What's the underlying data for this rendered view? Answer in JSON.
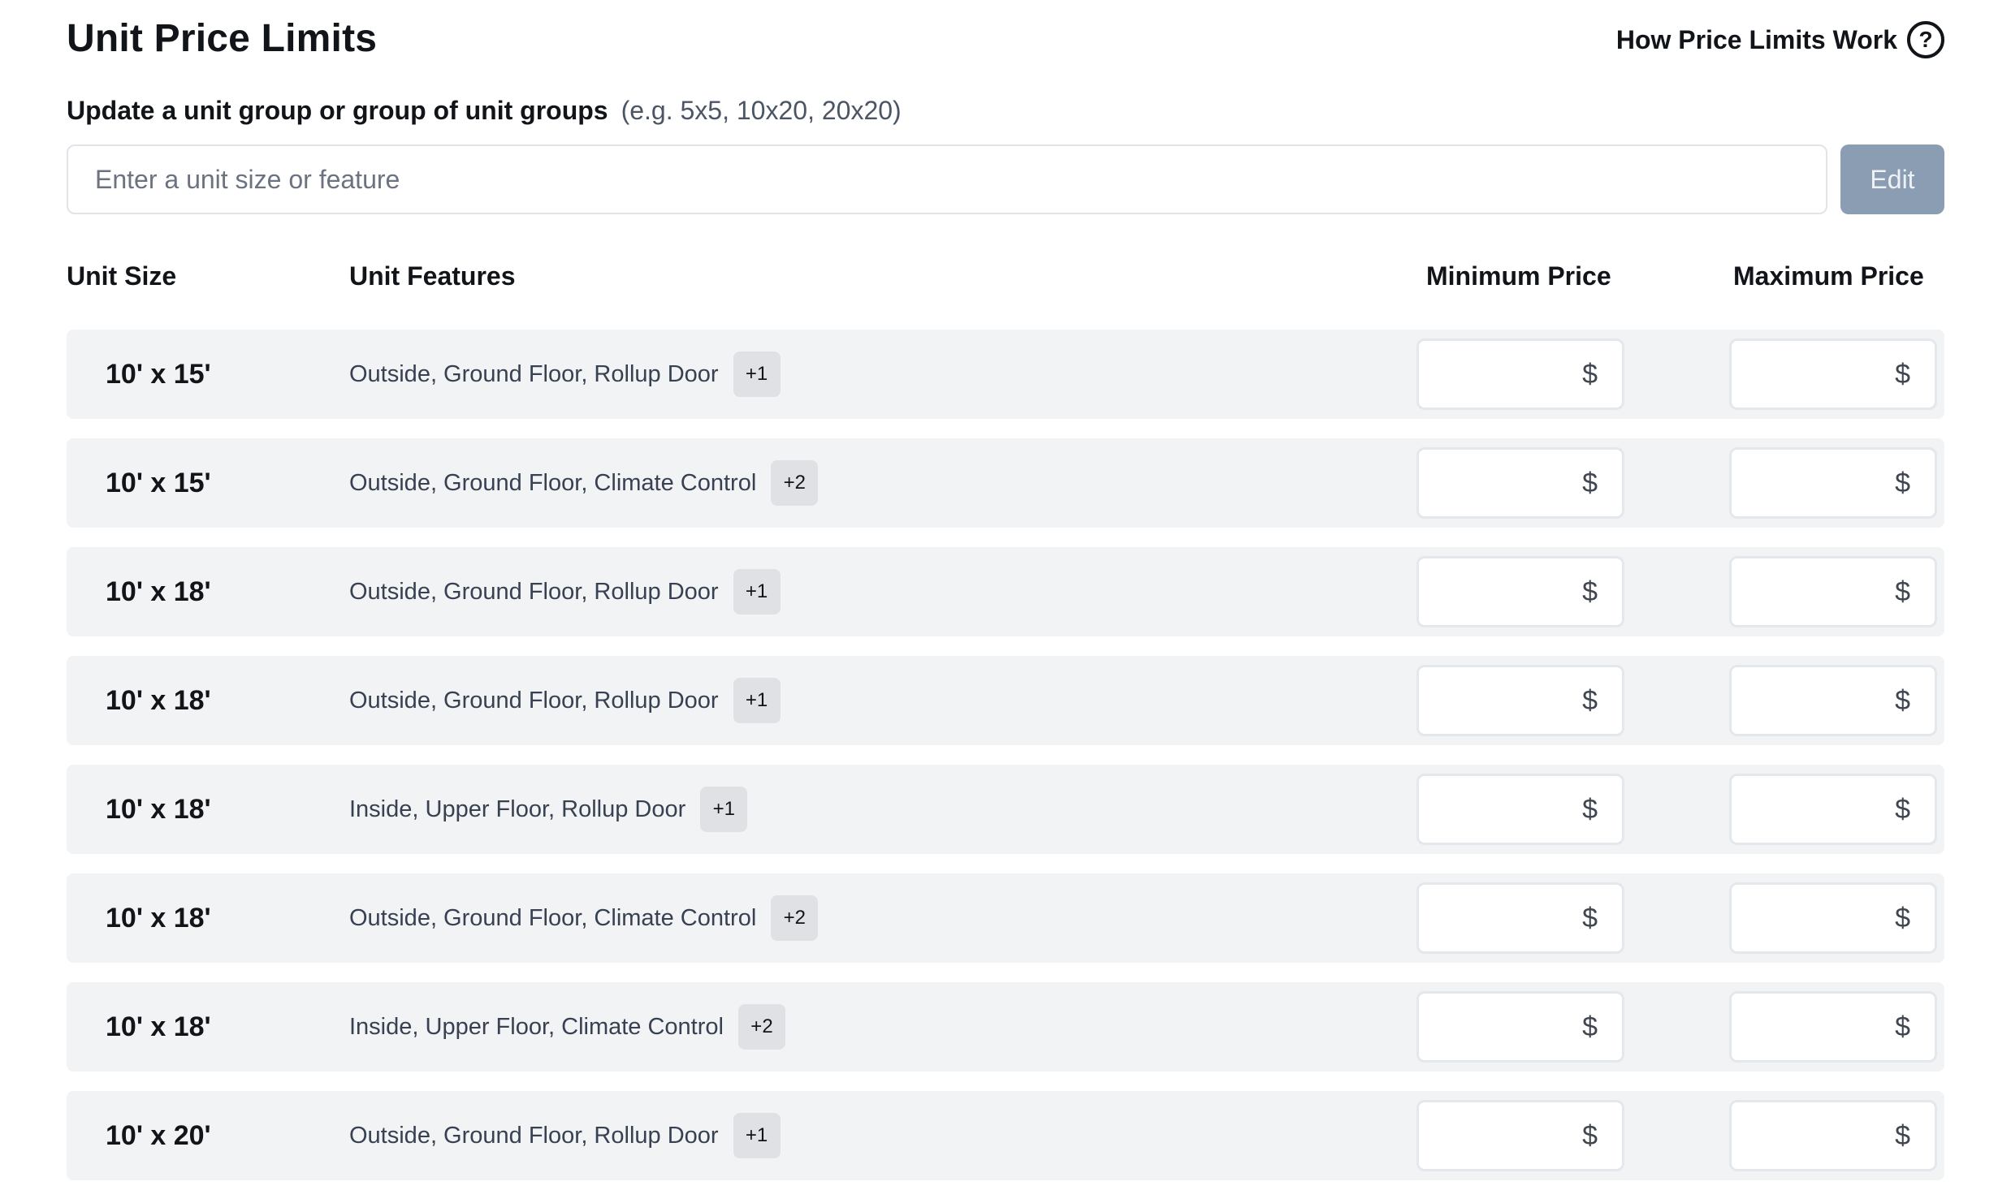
{
  "header": {
    "title": "Unit Price Limits",
    "help_label": "How Price Limits Work",
    "help_icon": "?"
  },
  "update": {
    "label": "Update a unit group or group of unit groups",
    "hint": "(e.g. 5x5, 10x20, 20x20)",
    "placeholder": "Enter a unit size or feature",
    "value": "",
    "edit_label": "Edit"
  },
  "columns": {
    "size": "Unit Size",
    "features": "Unit Features",
    "min": "Minimum Price",
    "max": "Maximum Price"
  },
  "currency_symbol": "$",
  "rows": [
    {
      "size": "10' x 15'",
      "features": "Outside, Ground Floor, Rollup Door",
      "more": "+1",
      "min": "",
      "max": ""
    },
    {
      "size": "10' x 15'",
      "features": "Outside, Ground Floor, Climate Control",
      "more": "+2",
      "min": "",
      "max": ""
    },
    {
      "size": "10' x 18'",
      "features": "Outside, Ground Floor, Rollup Door",
      "more": "+1",
      "min": "",
      "max": ""
    },
    {
      "size": "10' x 18'",
      "features": "Outside, Ground Floor, Rollup Door",
      "more": "+1",
      "min": "",
      "max": ""
    },
    {
      "size": "10' x 18'",
      "features": "Inside, Upper Floor, Rollup Door",
      "more": "+1",
      "min": "",
      "max": ""
    },
    {
      "size": "10' x 18'",
      "features": "Outside, Ground Floor, Climate Control",
      "more": "+2",
      "min": "",
      "max": ""
    },
    {
      "size": "10' x 18'",
      "features": "Inside, Upper Floor, Climate Control",
      "more": "+2",
      "min": "",
      "max": ""
    },
    {
      "size": "10' x 20'",
      "features": "Outside, Ground Floor, Rollup Door",
      "more": "+1",
      "min": "",
      "max": ""
    }
  ],
  "colors": {
    "row_bg": "#f2f3f5",
    "edit_button_bg": "#8b9db3",
    "badge_bg": "#dfe1e5"
  }
}
